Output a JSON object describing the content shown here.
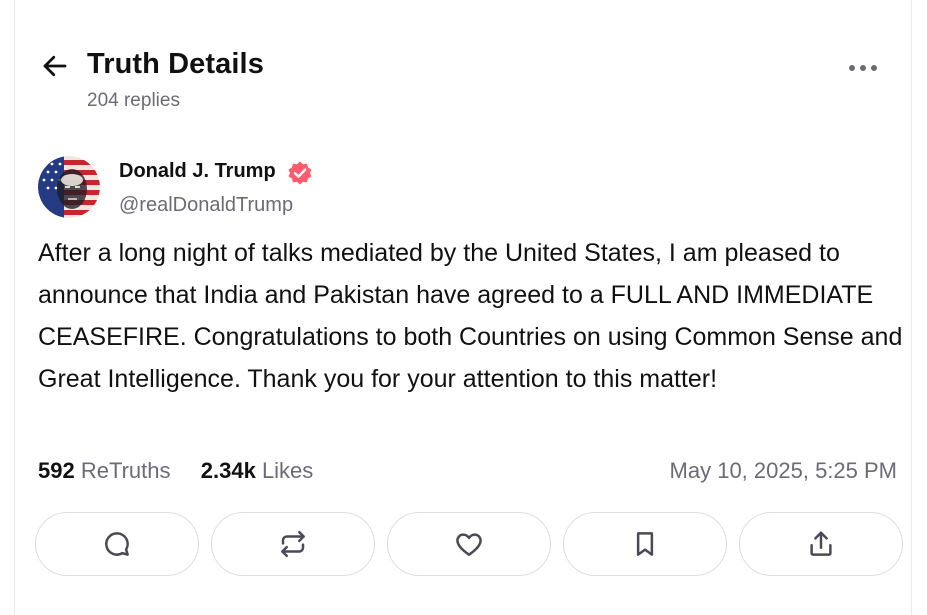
{
  "header": {
    "title": "Truth Details",
    "replies": "204 replies",
    "back_icon": "arrow-left-icon",
    "more_icon": "more-horizontal-icon"
  },
  "post": {
    "author_name": "Donald J. Trump",
    "author_handle": "@realDonaldTrump",
    "verified_icon": "verified-badge-icon",
    "verified_color": "#ff5b6f",
    "text": "After a long night of talks mediated by the United States, I am pleased to announce that India and Pakistan have agreed to a FULL AND IMMEDIATE CEASEFIRE. Congratulations to both Countries on using Common Sense and Great Intelligence. Thank you for your attention to this matter!",
    "retruths_count": "592",
    "retruths_label": "ReTruths",
    "likes_count": "2.34k",
    "likes_label": "Likes",
    "timestamp": "May 10, 2025, 5:25 PM"
  },
  "actions": [
    {
      "name": "reply-button",
      "icon": "comment-icon"
    },
    {
      "name": "retruth-button",
      "icon": "repost-icon"
    },
    {
      "name": "like-button",
      "icon": "heart-icon"
    },
    {
      "name": "bookmark-button",
      "icon": "bookmark-icon"
    },
    {
      "name": "share-button",
      "icon": "share-icon"
    }
  ],
  "colors": {
    "text_primary": "#111111",
    "text_secondary": "#6b6b75",
    "border": "#dedee3",
    "icon": "#4a4a55"
  }
}
